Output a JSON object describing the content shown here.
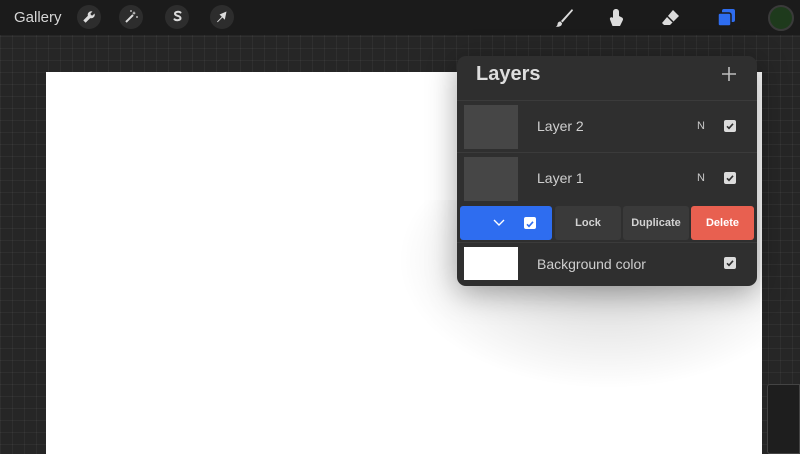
{
  "toolbar": {
    "gallery_label": "Gallery",
    "left_tools": [
      "wrench-icon",
      "magic-wand-icon",
      "selection-s-icon",
      "transform-arrow-icon"
    ],
    "right_tools": [
      "brush-icon",
      "smudge-icon",
      "eraser-icon",
      "layers-icon"
    ],
    "active_tool": "layers-icon",
    "accent_color": "#2e6df0",
    "current_color": "#1e3a1c"
  },
  "layers_panel": {
    "title": "Layers",
    "add_icon": "plus-icon",
    "layers": [
      {
        "name": "Layer 2",
        "blend_mode": "N",
        "visible": true
      },
      {
        "name": "Layer 1",
        "blend_mode": "N",
        "visible": true
      }
    ],
    "swipe_actions": {
      "lock_label": "Lock",
      "duplicate_label": "Duplicate",
      "delete_label": "Delete",
      "delete_color": "#e86050"
    },
    "background": {
      "name": "Background color",
      "color": "#ffffff",
      "visible": true
    }
  }
}
